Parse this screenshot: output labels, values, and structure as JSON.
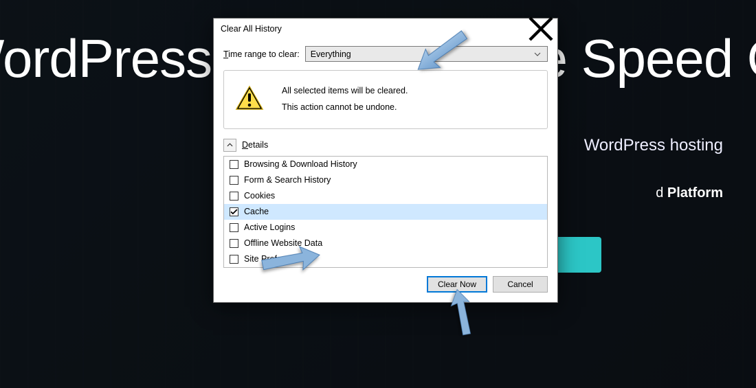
{
  "background": {
    "hero_title": "WordPress Hosting At The Speed Of",
    "hero_sub": "WordPress hosting",
    "hero_small_prefix": "d ",
    "hero_small_bold": "Platform"
  },
  "dialog": {
    "title": "Clear All History",
    "range_label_prefix": "T",
    "range_label_rest": "ime range to clear:",
    "range_value": "Everything",
    "warning_line1": "All selected items will be cleared.",
    "warning_line2": "This action cannot be undone.",
    "details_prefix": "D",
    "details_rest": "etails",
    "items": [
      {
        "label": "Browsing & Download History",
        "checked": false,
        "selected": false
      },
      {
        "label": "Form & Search History",
        "checked": false,
        "selected": false
      },
      {
        "label": "Cookies",
        "checked": false,
        "selected": false
      },
      {
        "label": "Cache",
        "checked": true,
        "selected": true
      },
      {
        "label": "Active Logins",
        "checked": false,
        "selected": false
      },
      {
        "label": "Offline Website Data",
        "checked": false,
        "selected": false
      },
      {
        "label": "Site Preferences",
        "checked": false,
        "selected": false
      }
    ],
    "primary_button": "Clear Now",
    "cancel_button": "Cancel"
  },
  "annotation_color": "#7aaad6"
}
